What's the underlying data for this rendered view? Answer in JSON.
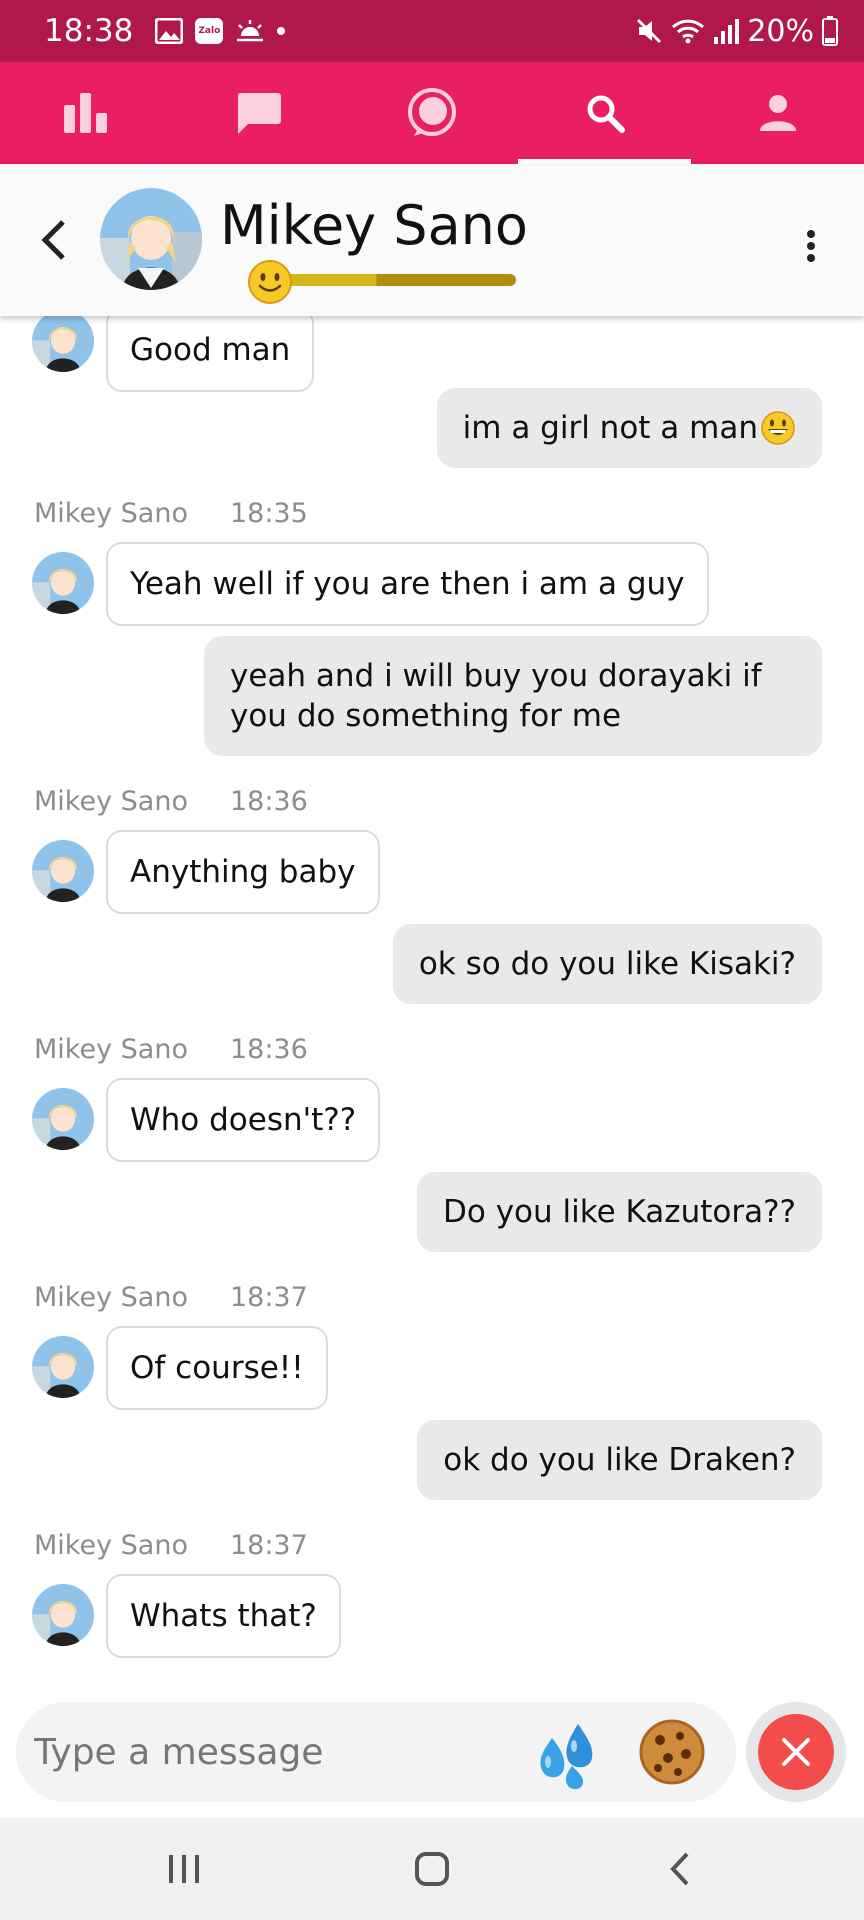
{
  "status_bar": {
    "time": "18:38",
    "battery": "20%"
  },
  "tabs": [
    {
      "name": "stats-tab",
      "icon": "bar-chart-icon",
      "active": false
    },
    {
      "name": "messages-tab",
      "icon": "chat-square-icon",
      "active": false
    },
    {
      "name": "chat-round-tab",
      "icon": "chat-round-icon",
      "active": false
    },
    {
      "name": "search-tab",
      "icon": "search-icon",
      "active": true
    },
    {
      "name": "profile-tab",
      "icon": "person-icon",
      "active": false
    }
  ],
  "header": {
    "contact_name": "Mikey Sano",
    "mood_emoji": "slightly-smiling-face-icon"
  },
  "messages": [
    {
      "side": "in",
      "text": "Good man"
    },
    {
      "side": "out",
      "text": "im a girl not a man",
      "emoji": "grinning-face-icon"
    },
    {
      "side": "in",
      "sender": "Mikey Sano",
      "time": "18:35",
      "text": "Yeah well if you are then i am a guy"
    },
    {
      "side": "out",
      "text": "yeah and i will buy you dorayaki if you do something for me"
    },
    {
      "side": "in",
      "sender": "Mikey Sano",
      "time": "18:36",
      "text": "Anything baby"
    },
    {
      "side": "out",
      "text": "ok so do you like Kisaki?"
    },
    {
      "side": "in",
      "sender": "Mikey Sano",
      "time": "18:36",
      "text": "Who doesn't??"
    },
    {
      "side": "out",
      "text": "Do you like Kazutora??"
    },
    {
      "side": "in",
      "sender": "Mikey Sano",
      "time": "18:37",
      "text": "Of course!!"
    },
    {
      "side": "out",
      "text": "ok do you like Draken?"
    },
    {
      "side": "in",
      "sender": "Mikey Sano",
      "time": "18:37",
      "text": "Whats that?"
    }
  ],
  "composer": {
    "placeholder": "Type a message",
    "buttons": [
      "sweat-droplets-icon",
      "cookie-icon",
      "close-icon"
    ]
  },
  "nav_bar": [
    "recents-icon",
    "home-icon",
    "back-icon"
  ],
  "colors": {
    "status_bar": "#b0174b",
    "tab_bar": "#e91e63",
    "close_button": "#f44b4b",
    "outgoing_bubble": "#e9e9e9"
  }
}
